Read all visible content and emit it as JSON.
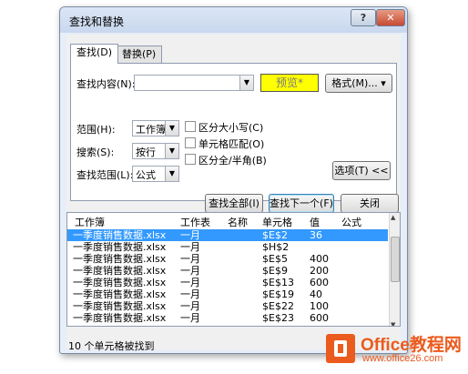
{
  "dialog": {
    "title": "查找和替换",
    "help_label": "?",
    "close_label": "✕"
  },
  "tabs": [
    {
      "label": "查找(D)"
    },
    {
      "label": "替换(P)"
    }
  ],
  "find": {
    "find_what_label": "查找内容(N):",
    "find_what_value": "",
    "preview_label": "预览*",
    "format_label": "格式(M)... ▾"
  },
  "options": {
    "within_label": "范围(H):",
    "within_value": "工作簿",
    "search_label": "搜索(S):",
    "search_value": "按行",
    "lookin_label": "查找范围(L):",
    "lookin_value": "公式",
    "match_case": "区分大小写(C)",
    "match_entire": "单元格匹配(O)",
    "match_byte": "区分全/半角(B)",
    "options_button": "选项(T) <<"
  },
  "buttons": {
    "find_all": "查找全部(I)",
    "find_next": "查找下一个(F)",
    "close": "关闭"
  },
  "results": {
    "headers": [
      "工作簿",
      "工作表",
      "名称",
      "单元格",
      "值",
      "公式"
    ],
    "rows": [
      {
        "book": "一季度销售数据.xlsx",
        "sheet": "一月",
        "name": "",
        "cell": "$E$2",
        "value": "36",
        "formula": ""
      },
      {
        "book": "一季度销售数据.xlsx",
        "sheet": "一月",
        "name": "",
        "cell": "$H$2",
        "value": "",
        "formula": ""
      },
      {
        "book": "一季度销售数据.xlsx",
        "sheet": "一月",
        "name": "",
        "cell": "$E$5",
        "value": "400",
        "formula": ""
      },
      {
        "book": "一季度销售数据.xlsx",
        "sheet": "一月",
        "name": "",
        "cell": "$E$9",
        "value": "200",
        "formula": ""
      },
      {
        "book": "一季度销售数据.xlsx",
        "sheet": "一月",
        "name": "",
        "cell": "$E$13",
        "value": "600",
        "formula": ""
      },
      {
        "book": "一季度销售数据.xlsx",
        "sheet": "一月",
        "name": "",
        "cell": "$E$19",
        "value": "40",
        "formula": ""
      },
      {
        "book": "一季度销售数据.xlsx",
        "sheet": "一月",
        "name": "",
        "cell": "$E$22",
        "value": "100",
        "formula": ""
      },
      {
        "book": "一季度销售数据.xlsx",
        "sheet": "一月",
        "name": "",
        "cell": "$E$23",
        "value": "600",
        "formula": ""
      }
    ],
    "status": "10 个单元格被找到"
  },
  "watermark": {
    "brand": "Office教程网",
    "url": "www.office26.com"
  },
  "colors": {
    "selection": "#3399ff",
    "preview_bg": "#ffff00",
    "logo_orange": "#eb5b1e"
  }
}
